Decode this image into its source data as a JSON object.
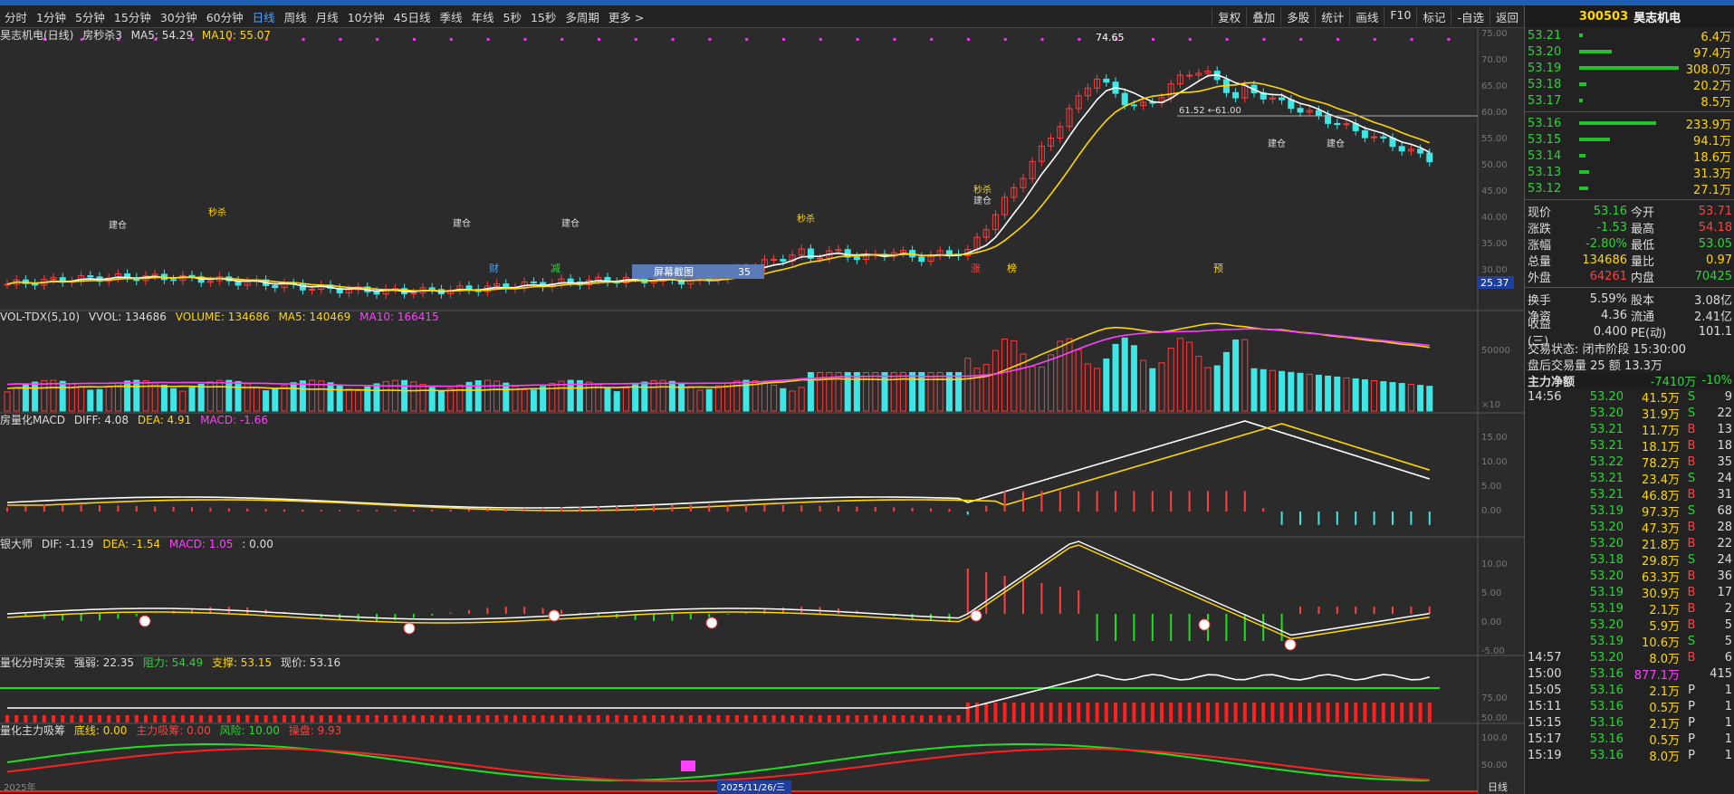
{
  "toolbar": {
    "timeframes": [
      "分时",
      "1分钟",
      "5分钟",
      "15分钟",
      "30分钟",
      "60分钟",
      "日线",
      "周线",
      "月线",
      "10分钟",
      "45日线",
      "季线",
      "年线",
      "5秒",
      "15秒",
      "多周期",
      "更多 >"
    ],
    "active_index": 6,
    "right_buttons": [
      "复权",
      "叠加",
      "多股",
      "统计",
      "画线",
      "F10",
      "标记",
      "-自选",
      "返回"
    ]
  },
  "panels": {
    "main": {
      "name": "昊志机电(日线)",
      "indicator": "房秒杀3",
      "ma5": "MA5: 54.29",
      "ma10": "MA10: 55.07"
    },
    "vol": {
      "name": "VOL-TDX(5,10)",
      "vvol": "VVOL: 134686",
      "volume": "VOLUME: 134686",
      "ma5": "MA5: 140469",
      "ma10": "MA10: 166415"
    },
    "macd": {
      "name": "房量化MACD",
      "diff": "DIFF: 4.08",
      "dea": "DEA: 4.91",
      "macd": "MACD: -1.66"
    },
    "yin": {
      "name": "银大师",
      "dif": "DIF: -1.19",
      "dea": "DEA: -1.54",
      "macd": "MACD: 1.05",
      "extra": ": 0.00"
    },
    "fs": {
      "name": "量化分时买卖",
      "qr": "强弱: 22.35",
      "zl": "阻力: 54.49",
      "zc": "支撑: 53.15",
      "xj": "现价: 53.16"
    },
    "zl": {
      "name": "量化主力吸筹",
      "dx": "底线: 0.00",
      "zlxc": "主力吸筹: 0.00",
      "fx": "风险: 10.00",
      "lp": "操盘: 9.93"
    }
  },
  "axis": {
    "main": [
      "75.00",
      "70.00",
      "65.00",
      "60.00",
      "55.00",
      "50.00",
      "45.00",
      "40.00",
      "35.00",
      "30.00"
    ],
    "vol": [
      "50000",
      "×10"
    ],
    "macd": [
      "15.00",
      "10.00",
      "5.00",
      "0.00"
    ],
    "yin": [
      "10.00",
      "5.00",
      "0.00",
      "-5.00"
    ],
    "fs": [
      "75.00",
      "50.00"
    ],
    "zl": [
      "100.0",
      "50.00"
    ],
    "price_tag": "25.37"
  },
  "labels": {
    "high": "74.65",
    "hline": "61.52 ←61.00",
    "date": "2025/11/26/三",
    "screenshot_btn": "屏幕截图",
    "screenshot_num": "35",
    "markers": [
      "财",
      "减",
      "涨",
      "榜",
      "预"
    ],
    "jiancang": "建仓",
    "miaosha": "秒杀",
    "year": "2025年",
    "dayline": "日线"
  },
  "side": {
    "code": "300503",
    "name": "昊志机电",
    "asks": [
      {
        "p": "53.21",
        "v": "6.4万",
        "w": 4
      },
      {
        "p": "53.20",
        "v": "97.4万",
        "w": 36
      },
      {
        "p": "53.19",
        "v": "308.0万",
        "w": 110
      },
      {
        "p": "53.18",
        "v": "20.2万",
        "w": 8
      },
      {
        "p": "53.17",
        "v": "8.5万",
        "w": 4
      }
    ],
    "bids": [
      {
        "p": "53.16",
        "v": "233.9万",
        "w": 85
      },
      {
        "p": "53.15",
        "v": "94.1万",
        "w": 34
      },
      {
        "p": "53.14",
        "v": "18.6万",
        "w": 7
      },
      {
        "p": "53.13",
        "v": "31.3万",
        "w": 11
      },
      {
        "p": "53.12",
        "v": "27.1万",
        "w": 10
      }
    ],
    "quote": [
      {
        "k": "现价",
        "v": "53.16",
        "vc": "g",
        "k2": "今开",
        "v2": "53.71",
        "v2c": "r"
      },
      {
        "k": "涨跌",
        "v": "-1.53",
        "vc": "g",
        "k2": "最高",
        "v2": "54.18",
        "v2c": "r"
      },
      {
        "k": "涨幅",
        "v": "-2.80%",
        "vc": "g",
        "k2": "最低",
        "v2": "53.05",
        "v2c": "g"
      },
      {
        "k": "总量",
        "v": "134686",
        "vc": "y",
        "k2": "量比",
        "v2": "0.97",
        "v2c": "y"
      },
      {
        "k": "外盘",
        "v": "64261",
        "vc": "r",
        "k2": "内盘",
        "v2": "70425",
        "v2c": "g"
      }
    ],
    "quote2": [
      {
        "k": "换手",
        "v": "5.59%",
        "k2": "股本",
        "v2": "3.08亿"
      },
      {
        "k": "净资",
        "v": "4.36",
        "k2": "流通",
        "v2": "2.41亿"
      },
      {
        "k": "收益(三)",
        "v": "0.400",
        "k2": "PE(动)",
        "v2": "101.1"
      }
    ],
    "status": "交易状态: 闭市阶段 15:30:00",
    "after": "盘后交易量 25 额 13.3万",
    "zljl": {
      "label": "主力净额",
      "v": "-7410万",
      "pct": "-10%"
    },
    "ticks": [
      {
        "t": "14:56",
        "p": "53.20",
        "v": "41.5万",
        "d": "S",
        "n": "9"
      },
      {
        "t": "",
        "p": "53.20",
        "v": "31.9万",
        "d": "S",
        "n": "22"
      },
      {
        "t": "",
        "p": "53.21",
        "v": "11.7万",
        "d": "B",
        "n": "13"
      },
      {
        "t": "",
        "p": "53.21",
        "v": "18.1万",
        "d": "B",
        "n": "18"
      },
      {
        "t": "",
        "p": "53.22",
        "v": "78.2万",
        "d": "B",
        "n": "35"
      },
      {
        "t": "",
        "p": "53.21",
        "v": "23.4万",
        "d": "S",
        "n": "24"
      },
      {
        "t": "",
        "p": "53.21",
        "v": "46.8万",
        "d": "B",
        "n": "31"
      },
      {
        "t": "",
        "p": "53.19",
        "v": "97.3万",
        "d": "S",
        "n": "68"
      },
      {
        "t": "",
        "p": "53.20",
        "v": "47.3万",
        "d": "B",
        "n": "28"
      },
      {
        "t": "",
        "p": "53.20",
        "v": "21.8万",
        "d": "B",
        "n": "22"
      },
      {
        "t": "",
        "p": "53.18",
        "v": "29.8万",
        "d": "S",
        "n": "24"
      },
      {
        "t": "",
        "p": "53.20",
        "v": "63.3万",
        "d": "B",
        "n": "36"
      },
      {
        "t": "",
        "p": "53.19",
        "v": "30.9万",
        "d": "B",
        "n": "17"
      },
      {
        "t": "",
        "p": "53.19",
        "v": "2.1万",
        "d": "B",
        "n": "2"
      },
      {
        "t": "",
        "p": "53.20",
        "v": "5.9万",
        "d": "B",
        "n": "5"
      },
      {
        "t": "",
        "p": "53.19",
        "v": "10.6万",
        "d": "S",
        "n": "5"
      },
      {
        "t": "14:57",
        "p": "53.20",
        "v": "8.0万",
        "d": "B",
        "n": "6"
      },
      {
        "t": "15:00",
        "p": "53.16",
        "v": "877.1万",
        "d": "",
        "n": "415"
      },
      {
        "t": "15:05",
        "p": "53.16",
        "v": "2.1万",
        "d": "P",
        "n": "1"
      },
      {
        "t": "15:11",
        "p": "53.16",
        "v": "0.5万",
        "d": "P",
        "n": "1"
      },
      {
        "t": "15:15",
        "p": "53.16",
        "v": "2.1万",
        "d": "P",
        "n": "1"
      },
      {
        "t": "15:17",
        "p": "53.16",
        "v": "0.5万",
        "d": "P",
        "n": "1"
      },
      {
        "t": "15:19",
        "p": "53.16",
        "v": "8.0万",
        "d": "P",
        "n": "1"
      }
    ]
  }
}
